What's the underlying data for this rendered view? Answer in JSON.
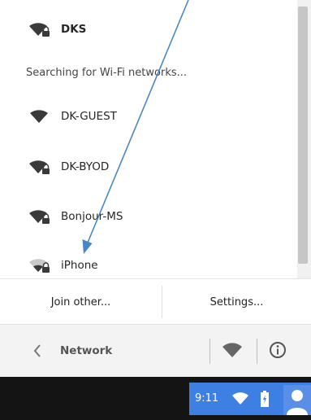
{
  "network_panel": {
    "active_network": "DKS",
    "status_text": "Searching for Wi-Fi networks...",
    "networks": [
      {
        "name": "DK-GUEST",
        "secured": false
      },
      {
        "name": "DK-BYOD",
        "secured": true
      },
      {
        "name": "Bonjour-MS",
        "secured": true
      },
      {
        "name": "iPhone",
        "secured": true
      }
    ]
  },
  "actions": {
    "join_other_label": "Join other...",
    "settings_label": "Settings..."
  },
  "footer": {
    "title": "Network"
  },
  "taskbar": {
    "time": "9:11"
  },
  "colors": {
    "tray_accent": "#3d7fe3",
    "annotation_arrow": "#4a86c5",
    "taskbar_bg": "#141414"
  },
  "icons": [
    "wifi-icon",
    "lock-icon",
    "chevron-left-icon",
    "info-icon",
    "battery-charging-icon",
    "user-avatar-icon"
  ]
}
